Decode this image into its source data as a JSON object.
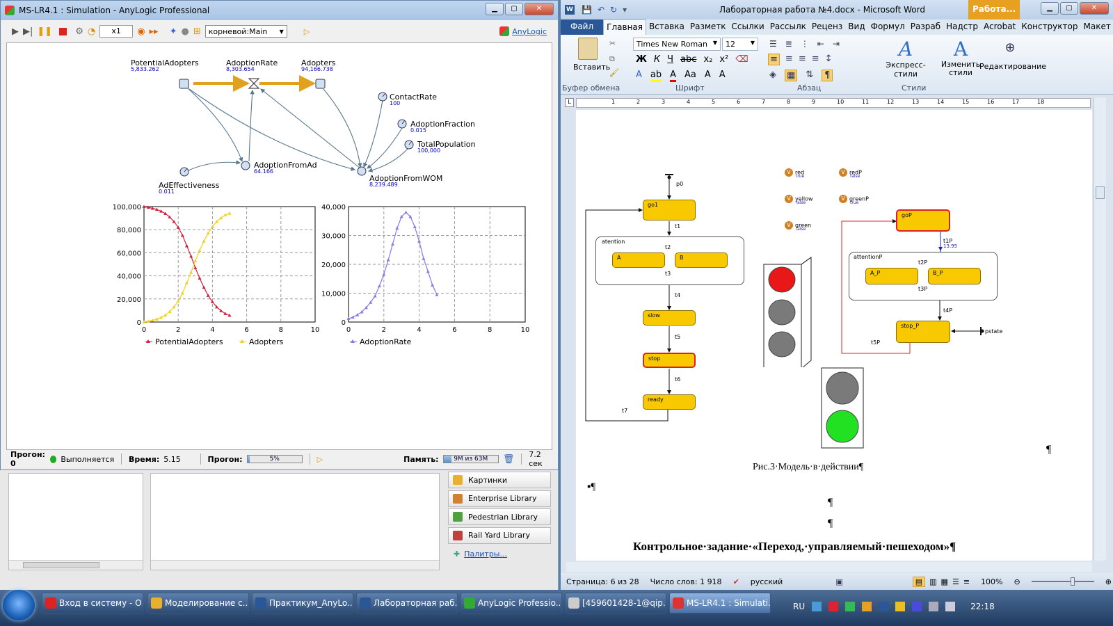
{
  "anylogic": {
    "title": "MS-LR4.1 : Simulation - AnyLogic Professional",
    "speed": "x1",
    "root_select": "корневой:Main",
    "brand": "AnyLogic",
    "nodes": {
      "potential": {
        "name": "PotentialAdopters",
        "value": "5,833.262"
      },
      "rate": {
        "name": "AdoptionRate",
        "value": "8,303.654"
      },
      "adopters": {
        "name": "Adopters",
        "value": "94,166.738"
      },
      "contact": {
        "name": "ContactRate",
        "value": "100"
      },
      "fraction": {
        "name": "AdoptionFraction",
        "value": "0.015"
      },
      "total": {
        "name": "TotalPopulation",
        "value": "100,000"
      },
      "fromad": {
        "name": "AdoptionFromAd",
        "value": "64.166"
      },
      "fromwom": {
        "name": "AdoptionFromWOM",
        "value": "8,239.489"
      },
      "adeff": {
        "name": "AdEffectiveness",
        "value": "0.011"
      }
    },
    "status": {
      "run_label": "Прогон: 0",
      "running": "Выполняется",
      "time_label": "Время:",
      "time": "5.15",
      "progress_label": "Прогон:",
      "progress_text": "5%",
      "progress": 0.05,
      "memory_label": "Память:",
      "memory_text": "9M из 63M",
      "memory": 0.14,
      "elapsed": "7.2 сек"
    },
    "palette": [
      "Картинки",
      "Enterprise Library",
      "Pedestrian Library",
      "Rail Yard Library"
    ],
    "palette_link": "Палитры..."
  },
  "chart_data": [
    {
      "type": "line",
      "x": [
        0,
        0.25,
        0.5,
        0.75,
        1,
        1.25,
        1.5,
        1.75,
        2,
        2.25,
        2.5,
        2.75,
        3,
        3.25,
        3.5,
        3.75,
        4,
        4.25,
        4.5,
        4.75,
        5
      ],
      "series": [
        {
          "name": "PotentialAdopters",
          "color": "#d0203c",
          "values": [
            100000,
            99300,
            98500,
            97500,
            96000,
            94000,
            91000,
            87000,
            82000,
            75000,
            66000,
            57000,
            47000,
            38000,
            30000,
            23000,
            17500,
            13000,
            9800,
            7300,
            5800
          ]
        },
        {
          "name": "Adopters",
          "color": "#f0d020",
          "values": [
            0,
            700,
            1500,
            2500,
            4000,
            6000,
            9000,
            13000,
            18000,
            25000,
            34000,
            43000,
            53000,
            62000,
            70000,
            77000,
            82500,
            87000,
            90200,
            92700,
            94200
          ]
        }
      ],
      "xlim": [
        0,
        10
      ],
      "ylim": [
        0,
        100000
      ],
      "x_ticks": [
        "0",
        "2",
        "4",
        "6",
        "8",
        "10"
      ],
      "y_ticks": [
        "0",
        "20,000",
        "40,000",
        "60,000",
        "80,000",
        "100,000"
      ],
      "grid": true,
      "legend": "bottom"
    },
    {
      "type": "line",
      "x": [
        0,
        0.25,
        0.5,
        0.75,
        1,
        1.25,
        1.5,
        1.75,
        2,
        2.25,
        2.5,
        2.75,
        3,
        3.25,
        3.5,
        3.75,
        4,
        4.25,
        4.5,
        4.75,
        5
      ],
      "series": [
        {
          "name": "AdoptionRate",
          "color": "#8878e8",
          "values": [
            1200,
            1700,
            2500,
            3500,
            5000,
            6800,
            9000,
            12500,
            16500,
            21500,
            27000,
            32500,
            36500,
            38000,
            36500,
            33000,
            28000,
            22000,
            17500,
            12800,
            9500
          ]
        }
      ],
      "xlim": [
        0,
        10
      ],
      "ylim": [
        0,
        40000
      ],
      "x_ticks": [
        "0",
        "2",
        "4",
        "6",
        "8",
        "10"
      ],
      "y_ticks": [
        "0",
        "10,000",
        "20,000",
        "30,000",
        "40,000"
      ],
      "grid": true,
      "legend": "bottom"
    }
  ],
  "word": {
    "title": "Лабораторная работа №4.docx - Microsoft Word",
    "context_tab": "Работа...",
    "tabs": [
      "Файл",
      "Главная",
      "Вставка",
      "Разметк",
      "Ссылки",
      "Рассылк",
      "Реценз",
      "Вид",
      "Формул",
      "Разраб",
      "Надстр",
      "Acrobat",
      "Конструктор",
      "Макет"
    ],
    "font": "Times New Roman",
    "size": "12",
    "groups": [
      "Буфер обмена",
      "Шрифт",
      "Абзац",
      "Стили"
    ],
    "paste": "Вставить",
    "express": "Экспресс-стили",
    "change": "Изменить стили",
    "edit": "Редактирование",
    "caption": "Рис.3·Модель·в·действии¶",
    "heading": "Контрольное·задание·«Переход,·управляемый·пешеходом»¶",
    "pilcrow": "¶",
    "bullet_pilcrow": "▪¶",
    "statusbar": {
      "page": "Страница: 6 из 28",
      "words": "Число слов: 1 918",
      "lang": "русский",
      "zoom": "100%"
    },
    "ruler": [
      "1",
      "2",
      "3",
      "4",
      "5",
      "6",
      "7",
      "8",
      "9",
      "10",
      "11",
      "12",
      "13",
      "14",
      "15",
      "16",
      "17",
      "18"
    ],
    "diagram": {
      "p0": "p0",
      "go1": "go1",
      "t1": "t1",
      "attention": "atention",
      "A": "A",
      "B": "B",
      "t2": "t2",
      "t3": "t3",
      "t4": "t4",
      "slow": "slow",
      "t5": "t5",
      "stop": "stop",
      "t6": "t6",
      "ready": "ready",
      "t7": "t7",
      "vars": [
        {
          "n": "red",
          "v": "true"
        },
        {
          "n": "redP",
          "v": "false"
        },
        {
          "n": "yellow",
          "v": "false"
        },
        {
          "n": "greenP",
          "v": "true"
        },
        {
          "n": "green",
          "v": "false"
        }
      ],
      "goP": "goP",
      "t1P": "t1P",
      "t1Pv": "13.95",
      "attentionP": "attentionP",
      "A_P": "A_P",
      "B_P": "B_P",
      "t2P": "t2P",
      "t3P": "t3P",
      "t4P": "t4P",
      "stop_P": "stop_P",
      "pstate": "pstate",
      "t5P": "t5P"
    }
  },
  "taskbar": {
    "items": [
      "Вход в систему - О...",
      "Моделирование с...",
      "Практикум_AnyLo...",
      "Лабораторная раб...",
      "AnyLogic Professio...",
      "[459601428-1@qip....",
      "MS-LR4.1 : Simulati..."
    ],
    "lang": "RU",
    "clock": "22:18"
  }
}
